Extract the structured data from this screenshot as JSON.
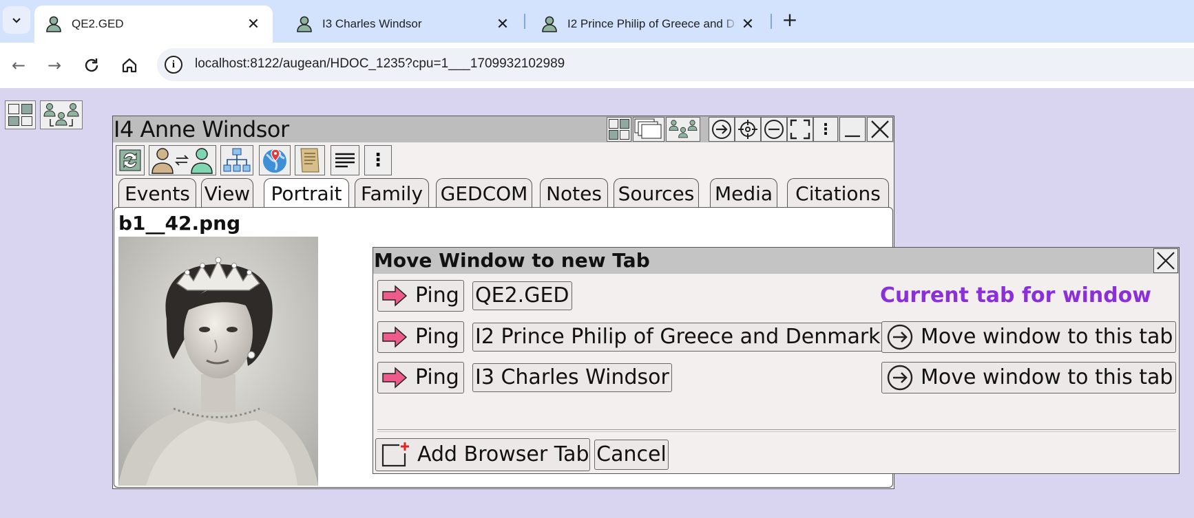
{
  "browser": {
    "tabs": [
      {
        "title": "QE2.GED",
        "active": true
      },
      {
        "title": "I3 Charles Windsor",
        "active": false
      },
      {
        "title": "I2 Prince Philip of Greece and D",
        "active": false
      }
    ],
    "url": "localhost:8122/augean/HDOC_1235?cpu=1___1709932102989"
  },
  "person_window": {
    "title": "I4 Anne Windsor",
    "tabs": [
      "Events",
      "View",
      "Portrait",
      "Family",
      "GEDCOM",
      "Notes",
      "Sources",
      "Media",
      "Citations"
    ],
    "selected_tab": "Portrait",
    "image_name": "b1__42.png"
  },
  "dialog": {
    "title": "Move Window to new Tab",
    "current_tab_label": "Current tab for window",
    "rows": [
      {
        "ping": "Ping",
        "tab": "QE2.GED",
        "action": ""
      },
      {
        "ping": "Ping",
        "tab": "I2 Prince Philip of Greece and Denmark",
        "action": "Move window to this tab"
      },
      {
        "ping": "Ping",
        "tab": "I3 Charles Windsor",
        "action": "Move window to this tab"
      }
    ],
    "add_tab_label": "Add Browser Tab",
    "cancel_label": "Cancel"
  },
  "colors": {
    "accent_purple": "#8b2fd9",
    "ping_arrow": "#ef5a8c",
    "page_bg": "#d9d4f0"
  }
}
